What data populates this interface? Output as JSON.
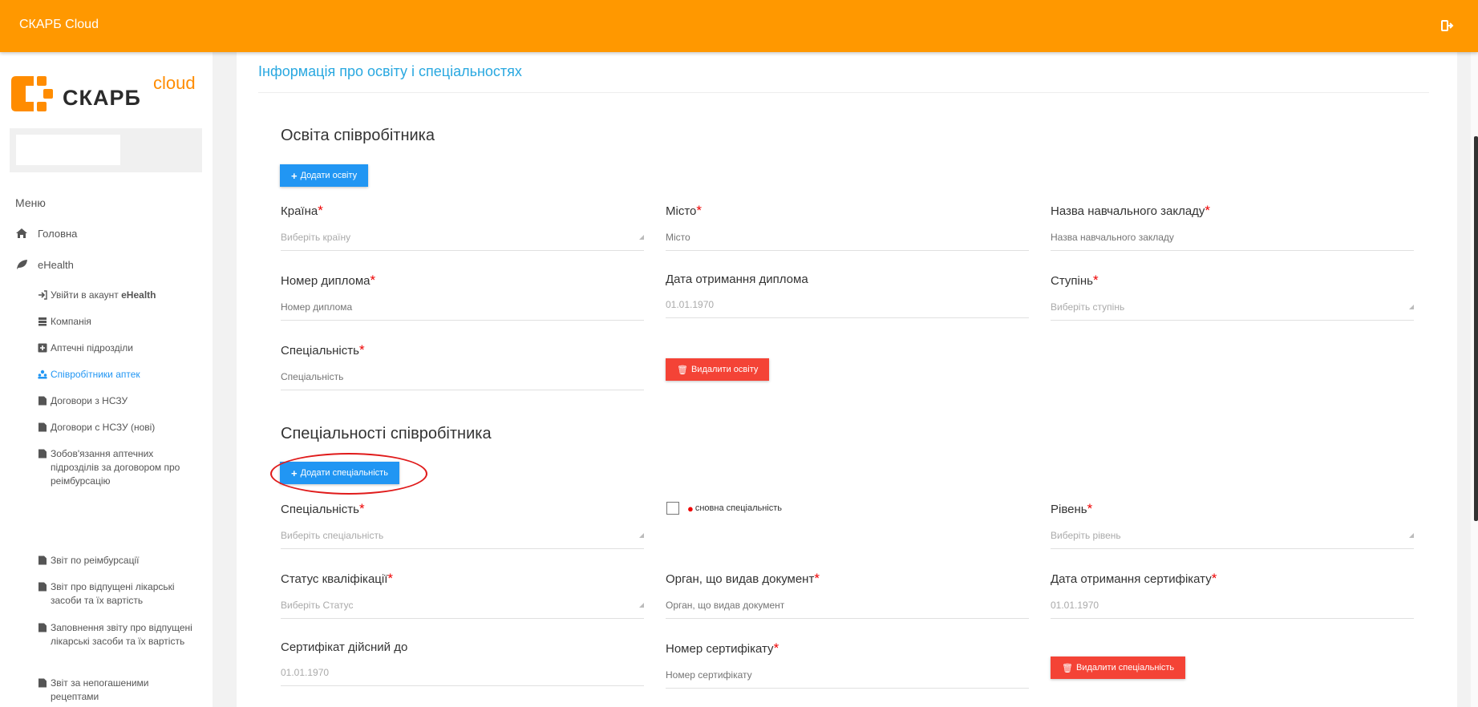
{
  "topbar": {
    "brand": "СКАРБ Cloud",
    "logout_icon": "sign-out-icon"
  },
  "sidebar": {
    "logo_text": "СКАРБ",
    "logo_sup": "cloud",
    "search_placeholder": "",
    "menu_title": "Меню",
    "items": [
      {
        "label": "Головна",
        "icon": "home-icon"
      },
      {
        "label": "eHealth",
        "icon": "leaf-icon"
      }
    ],
    "subitems": [
      {
        "label_pre": "Увійти в акаунт ",
        "label_bold": "eHealth",
        "icon": "sign-in-icon"
      },
      {
        "label": "Компанія",
        "icon": "database-icon"
      },
      {
        "label": "Аптечні підрозділи",
        "icon": "plus-square-icon"
      },
      {
        "label": "Співробітники аптек",
        "icon": "users-icon",
        "active": true
      },
      {
        "label": "Договори з НСЗУ",
        "icon": "file-icon"
      },
      {
        "label": "Договори с НСЗУ (нові)",
        "icon": "file-icon"
      },
      {
        "label": "Зобов'язання аптечних підрозділів за договором про реімбурсацію",
        "icon": "file-icon"
      },
      {
        "label": "Звіт по реімбурсації",
        "icon": "file-icon"
      },
      {
        "label": "Звіт про відпущені лікарські засоби та їх вартість",
        "icon": "file-icon"
      },
      {
        "label": "Заповнення звіту про відпущені лікарські засоби та їх вартість",
        "icon": "file-icon"
      },
      {
        "label": "Звіт за непогашеними рецептами",
        "icon": "file-icon"
      }
    ]
  },
  "main": {
    "page_title": "Інформація про освіту і спеціальностях",
    "education": {
      "title": "Освіта співробітника",
      "add_button": "Додати освіту",
      "delete_button": "Видалити освіту",
      "fields": {
        "country": {
          "label": "Країна",
          "placeholder": "Виберіть країну"
        },
        "city": {
          "label": "Місто",
          "placeholder": "Місто"
        },
        "institution": {
          "label": "Назва навчального закладу",
          "placeholder": "Назва навчального закладу"
        },
        "diploma_number": {
          "label": "Номер диплома",
          "placeholder": "Номер диплома"
        },
        "diploma_date": {
          "label": "Дата отримання диплома",
          "value": "01.01.1970"
        },
        "degree": {
          "label": "Ступінь",
          "placeholder": "Виберіть ступінь"
        },
        "specialty": {
          "label": "Спеціальність",
          "placeholder": "Спеціальність"
        }
      }
    },
    "specialties": {
      "title": "Спеціальності співробітника",
      "add_button": "Додати спеціальність",
      "delete_button": "Видалити спеціальність",
      "checkbox_label": "сновна спеціальність",
      "fields": {
        "specialty": {
          "label": "Спеціальність",
          "placeholder": "Виберіть спеціальність"
        },
        "level": {
          "label": "Рівень",
          "placeholder": "Виберіть рівень"
        },
        "qualification_status": {
          "label": "Статус кваліфікації",
          "placeholder": "Виберіть Статус"
        },
        "issuer": {
          "label": "Орган, що видав документ",
          "placeholder": "Орган, що видав документ"
        },
        "cert_date": {
          "label": "Дата отримання сертифікату",
          "value": "01.01.1970"
        },
        "cert_valid_until": {
          "label": "Сертифікат дійсний до",
          "value": "01.01.1970"
        },
        "cert_number": {
          "label": "Номер сертифікату",
          "placeholder": "Номер сертифікату"
        }
      }
    }
  },
  "colors": {
    "topbar": "#ff9800",
    "accent": "#2196f3",
    "danger": "#f44336",
    "title": "#29a8e0"
  }
}
